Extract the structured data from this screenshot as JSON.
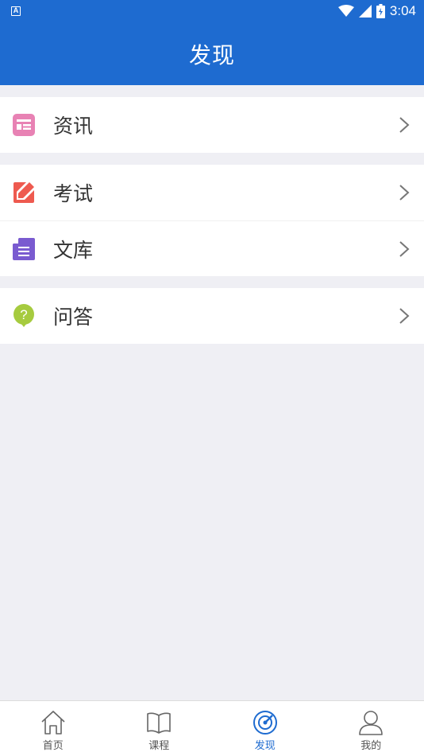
{
  "status": {
    "time": "3:04",
    "left_icon": "A"
  },
  "header": {
    "title": "发现"
  },
  "groups": [
    {
      "items": [
        {
          "label": "资讯",
          "icon": "news-icon",
          "color": "#e882b4"
        }
      ]
    },
    {
      "items": [
        {
          "label": "考试",
          "icon": "pencil-icon",
          "color": "#ee5a4f"
        },
        {
          "label": "文库",
          "icon": "document-icon",
          "color": "#7a5bd0"
        }
      ]
    },
    {
      "items": [
        {
          "label": "问答",
          "icon": "question-bubble-icon",
          "color": "#a6cb3f"
        }
      ]
    }
  ],
  "tabbar": {
    "tabs": [
      {
        "label": "首页",
        "icon": "home-icon"
      },
      {
        "label": "课程",
        "icon": "book-icon"
      },
      {
        "label": "发现",
        "icon": "discover-icon",
        "active": true
      },
      {
        "label": "我的",
        "icon": "user-icon"
      }
    ]
  },
  "colors": {
    "accent": "#1e6bd0",
    "background": "#efeff4"
  }
}
